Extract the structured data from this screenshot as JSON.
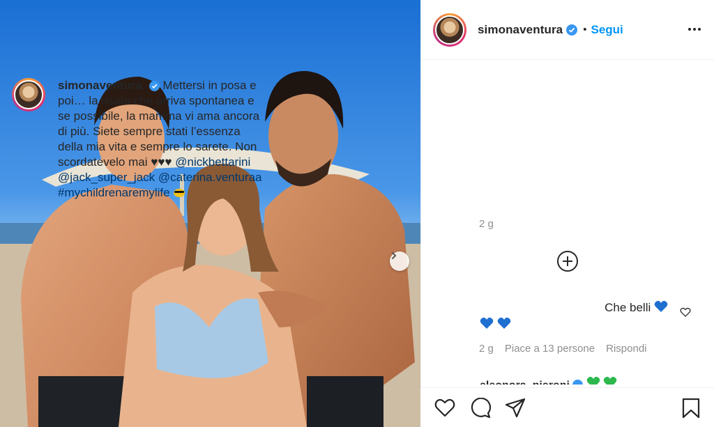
{
  "header": {
    "username": "simonaventura",
    "dot": "•",
    "follow_label": "Segui",
    "more_icon": "more-horizontal-icon"
  },
  "caption": {
    "username": "simonaventura",
    "text": "Mettersi in posa e poi… la risata che arriva spontanea e se possibile, la mamma vi ama ancora di più. Siete sempre stati l’essenza della mia vita e sempre lo sarete. Non scordatevelo mai ♥♥♥",
    "mentions": [
      "@nickbettarini",
      "@jack_super_jack",
      "@caterina.venturaa"
    ],
    "hashtag": "#mychildrenaremylife",
    "time": "2 g"
  },
  "comment": {
    "text": "Che belli",
    "time": "2 g",
    "likes": "Piace a 13 persone",
    "reply": "Rispondi"
  },
  "next_comment_peek": "eleonora_pieroni",
  "colors": {
    "link": "#00376b",
    "follow": "#0095f6",
    "muted": "#8e8e8e",
    "verified": "#3897f0",
    "blue_heart": "#1f6fd1",
    "green_heart": "#2db84d"
  },
  "icons": [
    "verified-badge-icon",
    "plus-circle-icon",
    "heart-icon",
    "comment-icon",
    "share-icon",
    "bookmark-icon",
    "chevron-right-icon"
  ]
}
